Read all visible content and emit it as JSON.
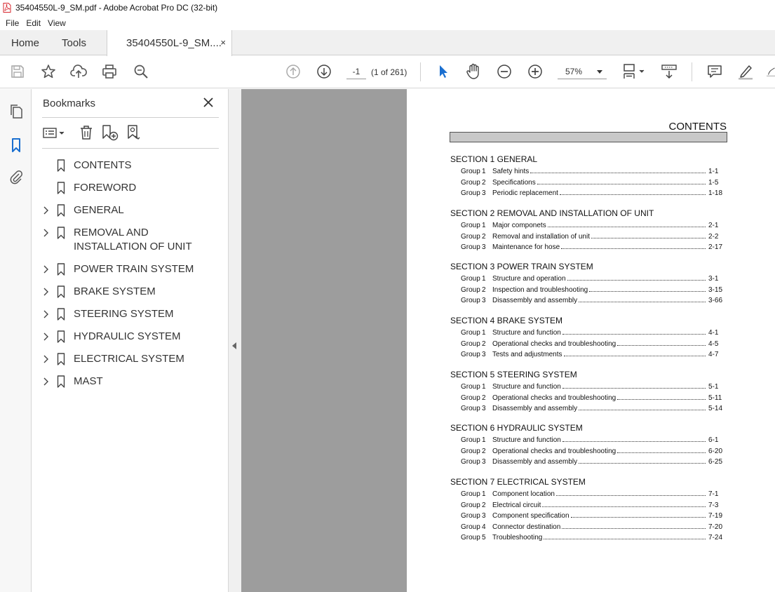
{
  "window": {
    "title": "35404550L-9_SM.pdf - Adobe Acrobat Pro DC (32-bit)"
  },
  "menu": [
    "File",
    "Edit",
    "View"
  ],
  "tabs": {
    "home": "Home",
    "tools": "Tools",
    "doc": "35404550L-9_SM....",
    "close": "×"
  },
  "toolbar": {
    "page_value": "-1",
    "page_count": "(1 of 261)",
    "zoom_value": "57%"
  },
  "bookmarks": {
    "title": "Bookmarks",
    "items": [
      {
        "label": "CONTENTS",
        "expandable": false
      },
      {
        "label": "FOREWORD",
        "expandable": false
      },
      {
        "label": "GENERAL",
        "expandable": true
      },
      {
        "label": "REMOVAL AND INSTALLATION OF UNIT",
        "expandable": true
      },
      {
        "label": "POWER TRAIN SYSTEM",
        "expandable": true
      },
      {
        "label": "BRAKE SYSTEM",
        "expandable": true
      },
      {
        "label": "STEERING SYSTEM",
        "expandable": true
      },
      {
        "label": "HYDRAULIC SYSTEM",
        "expandable": true
      },
      {
        "label": "ELECTRICAL SYSTEM",
        "expandable": true
      },
      {
        "label": "MAST",
        "expandable": true
      }
    ]
  },
  "page": {
    "heading": "CONTENTS",
    "sections": [
      {
        "title": "SECTION 1  GENERAL",
        "groups": [
          {
            "g": "Group",
            "n": "1",
            "t": "Safety hints",
            "p": "1-1"
          },
          {
            "g": "Group",
            "n": "2",
            "t": "Specifications",
            "p": "1-5"
          },
          {
            "g": "Group",
            "n": "3",
            "t": "Periodic replacement",
            "p": "1-18"
          }
        ]
      },
      {
        "title": "SECTION 2  REMOVAL AND INSTALLATION OF UNIT",
        "groups": [
          {
            "g": "Group",
            "n": "1",
            "t": "Major componets",
            "p": "2-1"
          },
          {
            "g": "Group",
            "n": "2",
            "t": "Removal and installation of unit",
            "p": "2-2"
          },
          {
            "g": "Group",
            "n": "3",
            "t": "Maintenance for hose",
            "p": "2-17"
          }
        ]
      },
      {
        "title": "SECTION 3  POWER TRAIN SYSTEM",
        "groups": [
          {
            "g": "Group",
            "n": "1",
            "t": "Structure and operation",
            "p": "3-1"
          },
          {
            "g": "Group",
            "n": "2",
            "t": "Inspection and troubleshooting",
            "p": "3-15"
          },
          {
            "g": "Group",
            "n": "3",
            "t": "Disassembly and assembly",
            "p": "3-66"
          }
        ]
      },
      {
        "title": "SECTION 4  BRAKE SYSTEM",
        "groups": [
          {
            "g": "Group",
            "n": "1",
            "t": "Structure and function",
            "p": "4-1"
          },
          {
            "g": "Group",
            "n": "2",
            "t": "Operational checks and troubleshooting",
            "p": "4-5"
          },
          {
            "g": "Group",
            "n": "3",
            "t": "Tests and adjustments",
            "p": "4-7"
          }
        ]
      },
      {
        "title": "SECTION 5  STEERING SYSTEM",
        "groups": [
          {
            "g": "Group",
            "n": "1",
            "t": "Structure and function",
            "p": "5-1"
          },
          {
            "g": "Group",
            "n": "2",
            "t": "Operational checks and troubleshooting",
            "p": "5-11"
          },
          {
            "g": "Group",
            "n": "3",
            "t": "Disassembly and assembly",
            "p": "5-14"
          }
        ]
      },
      {
        "title": "SECTION 6  HYDRAULIC SYSTEM",
        "groups": [
          {
            "g": "Group",
            "n": "1",
            "t": "Structure and function",
            "p": "6-1"
          },
          {
            "g": "Group",
            "n": "2",
            "t": "Operational checks and troubleshooting",
            "p": "6-20"
          },
          {
            "g": "Group",
            "n": "3",
            "t": "Disassembly and assembly",
            "p": "6-25"
          }
        ]
      },
      {
        "title": "SECTION 7  ELECTRICAL SYSTEM",
        "groups": [
          {
            "g": "Group",
            "n": "1",
            "t": "Component location",
            "p": "7-1"
          },
          {
            "g": "Group",
            "n": "2",
            "t": "Electrical circuit",
            "p": "7-3"
          },
          {
            "g": "Group",
            "n": "3",
            "t": "Component specification",
            "p": "7-19"
          },
          {
            "g": "Group",
            "n": "4",
            "t": "Connector destination",
            "p": "7-20"
          },
          {
            "g": "Group",
            "n": "5",
            "t": "Troubleshooting",
            "p": "7-24"
          }
        ]
      }
    ]
  },
  "colors": {
    "accent_blue": "#1a6fd0",
    "doc_gray": "#9d9d9d",
    "pdf_red": "#d7282f"
  },
  "icons": [
    "pdf-file-icon",
    "save-icon",
    "star-icon",
    "upload-icon",
    "print-icon",
    "zoom-search-icon",
    "page-up-icon",
    "page-down-icon",
    "select-arrow-icon",
    "hand-icon",
    "zoom-out-icon",
    "zoom-in-icon",
    "fit-page-icon",
    "scroll-mode-icon",
    "comment-icon",
    "highlight-pen-icon",
    "draw-icon",
    "pages-thumbnail-icon",
    "bookmark-icon",
    "paperclip-icon",
    "close-icon",
    "options-list-icon",
    "delete-icon",
    "new-bookmark-icon",
    "find-bookmark-icon",
    "chevron-right-icon"
  ]
}
